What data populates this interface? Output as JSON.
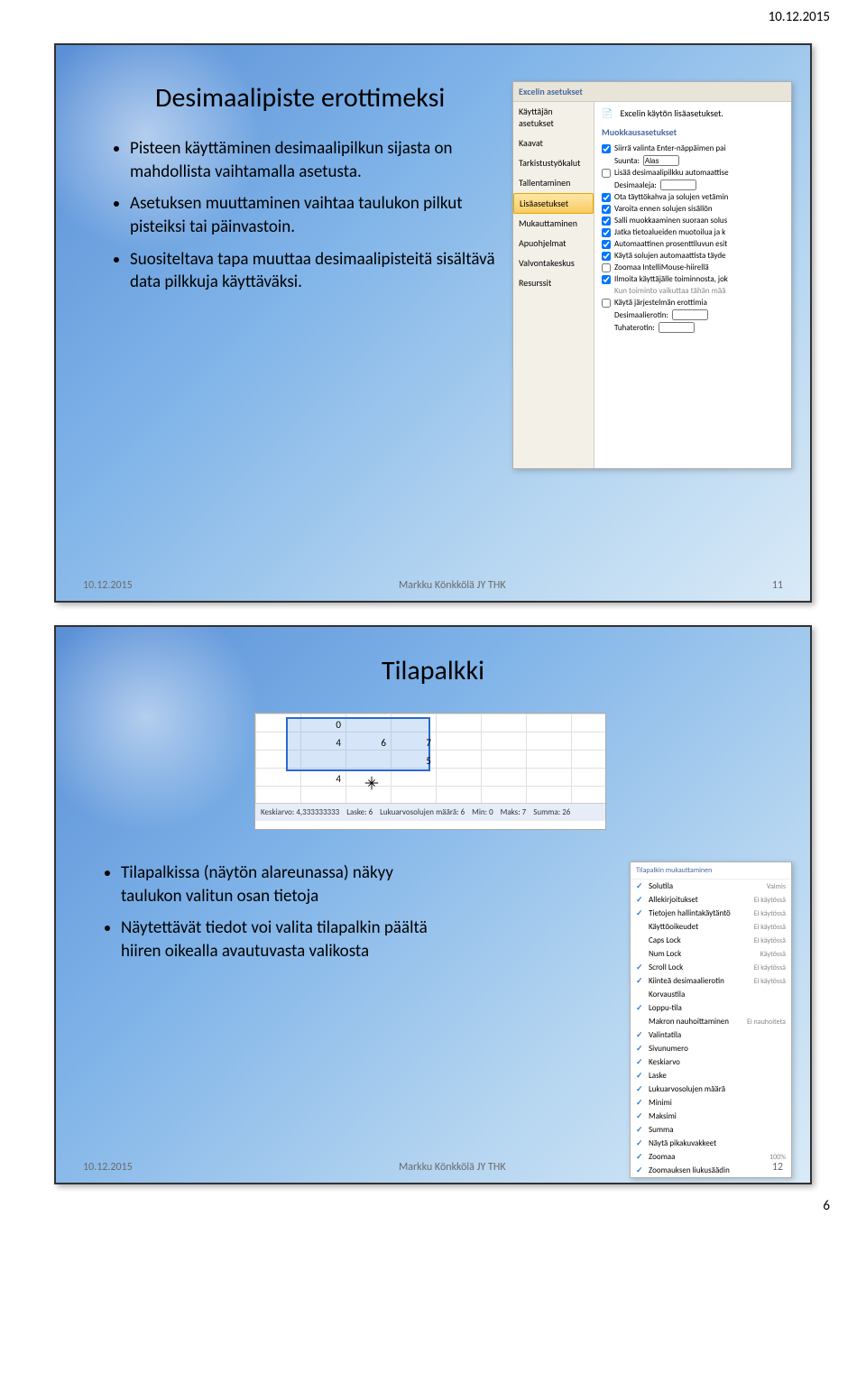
{
  "page": {
    "date": "10.12.2015",
    "number": "6"
  },
  "slide1": {
    "title": "Desimaalipiste erottimeksi",
    "bullets": [
      "Pisteen käyttäminen desimaalipilkun sijasta on mahdollista vaihtamalla asetusta.",
      "Asetuksen muuttaminen vaihtaa taulukon pilkut pisteiksi tai päinvastoin.",
      "Suositeltava tapa muuttaa desimaalipisteitä sisältävä data pilkkuja käyttäväksi."
    ],
    "footer": {
      "date": "10.12.2015",
      "author": "Markku Könkkölä JY THK",
      "num": "11"
    },
    "excel": {
      "windowTitle": "Excelin asetukset",
      "side": [
        "Käyttäjän asetukset",
        "Kaavat",
        "Tarkistustyökalut",
        "Tallentaminen",
        "Lisäasetukset",
        "Mukauttaminen",
        "Apuohjelmat",
        "Valvontakeskus",
        "Resurssit"
      ],
      "sideSelected": 4,
      "mainHeader": "Excelin käytön lisäasetukset.",
      "section1": "Muokkausasetukset",
      "opts": [
        {
          "c": true,
          "t": "Siirrä valinta Enter-näppäimen pai"
        },
        {
          "label": "Suunta:",
          "val": "Alas"
        },
        {
          "c": false,
          "t": "Lisää desimaalipilkku automaattise"
        },
        {
          "label": "Desimaaleja:",
          "val": ""
        },
        {
          "c": true,
          "t": "Ota täyttökahva ja solujen vetämin"
        },
        {
          "c": true,
          "t": "Varoita ennen solujen sisällön"
        },
        {
          "c": true,
          "t": "Salli muokkaaminen suoraan solus"
        },
        {
          "c": true,
          "t": "Jatka tietoalueiden muotoilua ja k"
        },
        {
          "c": true,
          "t": "Automaattinen prosenttiluvun esit"
        },
        {
          "c": true,
          "t": "Käytä solujen automaattista täyde"
        },
        {
          "c": false,
          "t": "Zoomaa IntelliMouse-hiirellä"
        },
        {
          "c": true,
          "t": "Ilmoita käyttäjälle toiminnosta, jok"
        },
        {
          "label2": "Kun toiminto vaikuttaa tähän mää"
        },
        {
          "c": false,
          "t": "Käytä järjestelmän erottimia"
        },
        {
          "label": "Desimaalierotin:",
          "val": ""
        },
        {
          "label": "Tuhaterotin:",
          "val": ""
        }
      ]
    }
  },
  "slide2": {
    "title": "Tilapalkki",
    "bullets": [
      "Tilapalkissa (näytön alareunassa) näkyy taulukon valitun osan tietoja",
      "Näytettävät tiedot voi valita tilapalkin päältä hiiren oikealla avautuvasta valikosta"
    ],
    "footer": {
      "date": "10.12.2015",
      "author": "Markku Könkkölä JY THK",
      "num": "12"
    },
    "grid": {
      "cells": [
        {
          "v": "0",
          "t": 6,
          "l": 55
        },
        {
          "v": "4",
          "t": 26,
          "l": 55
        },
        {
          "v": "6",
          "t": 26,
          "l": 105
        },
        {
          "v": "7",
          "t": 26,
          "l": 155
        },
        {
          "v": "5",
          "t": 46,
          "l": 155
        },
        {
          "v": "4",
          "t": 66,
          "l": 55
        }
      ],
      "status": [
        {
          "k": "Keskiarvo:",
          "v": "4,333333333"
        },
        {
          "k": "Laske:",
          "v": "6"
        },
        {
          "k": "Lukuarvosolujen määrä:",
          "v": "6"
        },
        {
          "k": "Min:",
          "v": "0"
        },
        {
          "k": "Maks:",
          "v": "7"
        },
        {
          "k": "Summa:",
          "v": "26"
        }
      ]
    },
    "menu": {
      "header": "Tilapalkin mukauttaminen",
      "items": [
        {
          "c": true,
          "t": "Solutila",
          "r": "Valmis"
        },
        {
          "c": true,
          "t": "Allekirjoitukset",
          "r": "Ei käytössä"
        },
        {
          "c": true,
          "t": "Tietojen hallintakäytäntö",
          "r": "Ei käytössä"
        },
        {
          "c": false,
          "t": "Käyttöoikeudet",
          "r": "Ei käytössä"
        },
        {
          "c": false,
          "t": "Caps Lock",
          "r": "Ei käytössä"
        },
        {
          "c": false,
          "t": "Num Lock",
          "r": "Käytössä"
        },
        {
          "c": true,
          "t": "Scroll Lock",
          "r": "Ei käytössä"
        },
        {
          "c": true,
          "t": "Kiinteä desimaalierotin",
          "r": "Ei käytössä"
        },
        {
          "c": false,
          "t": "Korvaustila"
        },
        {
          "c": true,
          "t": "Loppu-tila"
        },
        {
          "c": false,
          "t": "Makron nauhoittaminen",
          "r": "Ei nauhoiteta"
        },
        {
          "c": true,
          "t": "Valintatila"
        },
        {
          "c": true,
          "t": "Sivunumero"
        },
        {
          "c": true,
          "t": "Keskiarvo"
        },
        {
          "c": true,
          "t": "Laske"
        },
        {
          "c": true,
          "t": "Lukuarvosolujen määrä"
        },
        {
          "c": true,
          "t": "Minimi"
        },
        {
          "c": true,
          "t": "Maksimi"
        },
        {
          "c": true,
          "t": "Summa"
        },
        {
          "c": true,
          "t": "Näytä pikakuvakkeet"
        },
        {
          "c": true,
          "t": "Zoomaa",
          "r": "100%"
        },
        {
          "c": true,
          "t": "Zoomauksen liukusäädin"
        }
      ]
    }
  }
}
